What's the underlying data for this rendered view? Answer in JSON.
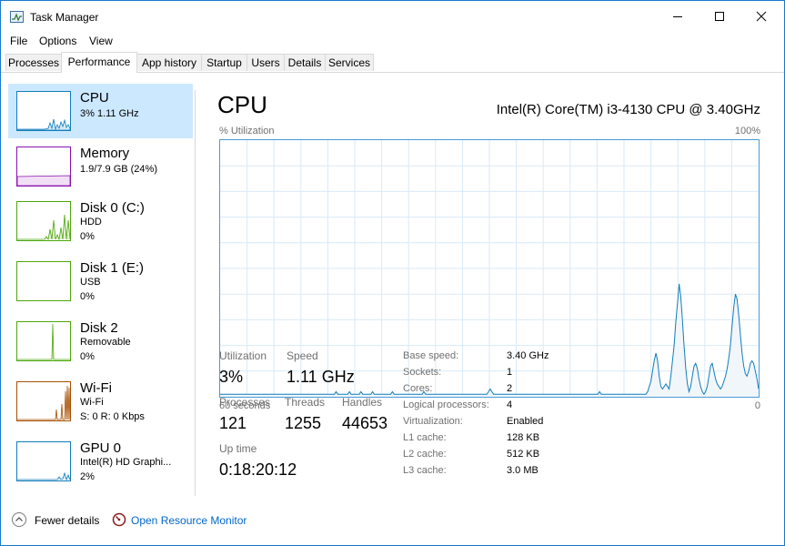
{
  "window": {
    "title": "Task Manager",
    "app_icon": "task-manager-icon"
  },
  "menu": [
    "File",
    "Options",
    "View"
  ],
  "tabs": [
    "Processes",
    "Performance",
    "App history",
    "Startup",
    "Users",
    "Details",
    "Services"
  ],
  "active_tab": "Performance",
  "sidebar": {
    "items": [
      {
        "title": "CPU",
        "lines": [
          "3% 1.11 GHz"
        ],
        "color": "#117dbb",
        "selected": true
      },
      {
        "title": "Memory",
        "lines": [
          "1.9/7.9 GB (24%)"
        ],
        "color": "#8b12ae"
      },
      {
        "title": "Disk 0 (C:)",
        "lines": [
          "HDD",
          "0%"
        ],
        "color": "#4da60c"
      },
      {
        "title": "Disk 1 (E:)",
        "lines": [
          "USB",
          "0%"
        ],
        "color": "#4da60c"
      },
      {
        "title": "Disk 2",
        "lines": [
          "Removable",
          "0%"
        ],
        "color": "#4da60c"
      },
      {
        "title": "Wi-Fi",
        "lines": [
          "Wi-Fi",
          "S: 0 R: 0 Kbps"
        ],
        "color": "#a74f01"
      },
      {
        "title": "GPU 0",
        "lines": [
          "Intel(R) HD Graphi...",
          "2%"
        ],
        "color": "#117dbb"
      }
    ]
  },
  "cpu_panel": {
    "title": "CPU",
    "processor": "Intel(R) Core(TM) i3-4130 CPU @ 3.40GHz",
    "graph_label": "% Utilization",
    "graph_max": "100%",
    "graph_time": "60 seconds",
    "graph_min": "0",
    "stats": {
      "utilization": {
        "label": "Utilization",
        "value": "3%"
      },
      "speed": {
        "label": "Speed",
        "value": "1.11 GHz"
      },
      "processes": {
        "label": "Processes",
        "value": "121"
      },
      "threads": {
        "label": "Threads",
        "value": "1255"
      },
      "handles": {
        "label": "Handles",
        "value": "44653"
      },
      "uptime": {
        "label": "Up time",
        "value": "0:18:20:12"
      }
    },
    "details": [
      {
        "label": "Base speed:",
        "value": "3.40 GHz"
      },
      {
        "label": "Sockets:",
        "value": "1"
      },
      {
        "label": "Cores:",
        "value": "2"
      },
      {
        "label": "Logical processors:",
        "value": "4"
      },
      {
        "label": "Virtualization:",
        "value": "Enabled"
      },
      {
        "label": "L1 cache:",
        "value": "128 KB"
      },
      {
        "label": "L2 cache:",
        "value": "512 KB"
      },
      {
        "label": "L3 cache:",
        "value": "3.0 MB"
      }
    ]
  },
  "chart_data": {
    "type": "area",
    "title": "CPU",
    "ylabel": "% Utilization",
    "ylim": [
      0,
      100
    ],
    "x_range_seconds": 60,
    "values": [
      1,
      1,
      1,
      1,
      1,
      1,
      1,
      1,
      1,
      1,
      1,
      1,
      1,
      1,
      1,
      1,
      1,
      1,
      1,
      1,
      1,
      1,
      1,
      1,
      1,
      1,
      1,
      1,
      1,
      1,
      1,
      1,
      1,
      1,
      1,
      1,
      1,
      1,
      1,
      1,
      1,
      1,
      1,
      1,
      1,
      1,
      1,
      1,
      1,
      1,
      1,
      1,
      1,
      1,
      1,
      1,
      1,
      1,
      1,
      1,
      1,
      1,
      1,
      1,
      1,
      1,
      1,
      1,
      1,
      1,
      2,
      1,
      1,
      1,
      1,
      1,
      1,
      1,
      2,
      1,
      1,
      1,
      1,
      1,
      1,
      2,
      1,
      1,
      1,
      1,
      1,
      1,
      2,
      1,
      1,
      1,
      1,
      1,
      1,
      1,
      1,
      1,
      1,
      1,
      2,
      1,
      1,
      1,
      1,
      1,
      1,
      1,
      1,
      1,
      1,
      1,
      1,
      1,
      1,
      1,
      1,
      1,
      1,
      2,
      1,
      1,
      1,
      1,
      1,
      1,
      1,
      1,
      1,
      1,
      1,
      1,
      1,
      1,
      1,
      1,
      1,
      1,
      1,
      1,
      1,
      1,
      1,
      1,
      1,
      1,
      1,
      1,
      1,
      1,
      1,
      1,
      1,
      1,
      1,
      1,
      1,
      1,
      2,
      3,
      2,
      1,
      1,
      1,
      1,
      1,
      1,
      1,
      1,
      1,
      1,
      1,
      1,
      1,
      1,
      1,
      1,
      1,
      1,
      1,
      1,
      1,
      1,
      1,
      1,
      1,
      1,
      1,
      1,
      1,
      1,
      1,
      1,
      1,
      1,
      1,
      1,
      1,
      1,
      1,
      1,
      1,
      1,
      1,
      1,
      1,
      1,
      1,
      1,
      1,
      1,
      1,
      1,
      1,
      1,
      1,
      1,
      1,
      1,
      1,
      1,
      1,
      1,
      1,
      1,
      2,
      1,
      1,
      1,
      1,
      1,
      1,
      1,
      1,
      1,
      1,
      1,
      1,
      1,
      1,
      1,
      1,
      1,
      1,
      1,
      1,
      1,
      1,
      1,
      1,
      1,
      1,
      1,
      1,
      2,
      4,
      6,
      10,
      14,
      17,
      14,
      8,
      4,
      3,
      4,
      5,
      4,
      3,
      8,
      14,
      20,
      29,
      36,
      44,
      39,
      30,
      20,
      11,
      5,
      2,
      4,
      8,
      12,
      13,
      11,
      7,
      4,
      2,
      1,
      2,
      4,
      8,
      12,
      13,
      10,
      7,
      5,
      4,
      3,
      4,
      6,
      8,
      11,
      15,
      20,
      28,
      35,
      40,
      38,
      32,
      24,
      17,
      12,
      9,
      8,
      10,
      13,
      14,
      13,
      10,
      7,
      3
    ]
  },
  "footer": {
    "fewer_details": "Fewer details",
    "resource_monitor": "Open Resource Monitor"
  }
}
